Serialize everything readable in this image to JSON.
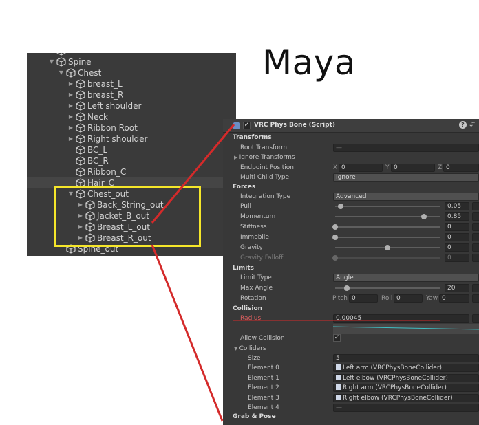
{
  "title": "Maya",
  "hierarchy": {
    "rows": [
      {
        "label": "",
        "depth": 2,
        "arrow": "",
        "icon": "cube-icon",
        "partial": true
      },
      {
        "label": "Spine",
        "depth": 2,
        "arrow": "▼",
        "icon": "cube-icon"
      },
      {
        "label": "Chest",
        "depth": 3,
        "arrow": "▼",
        "icon": "cube-icon"
      },
      {
        "label": "breast_L",
        "depth": 4,
        "arrow": "▶",
        "icon": "cube-icon"
      },
      {
        "label": "breast_R",
        "depth": 4,
        "arrow": "▶",
        "icon": "cube-icon"
      },
      {
        "label": "Left shoulder",
        "depth": 4,
        "arrow": "▶",
        "icon": "cube-icon"
      },
      {
        "label": "Neck",
        "depth": 4,
        "arrow": "▶",
        "icon": "cube-icon"
      },
      {
        "label": "Ribbon Root",
        "depth": 4,
        "arrow": "▶",
        "icon": "cube-icon"
      },
      {
        "label": "Right shoulder",
        "depth": 4,
        "arrow": "▶",
        "icon": "cube-icon"
      },
      {
        "label": "BC_L",
        "depth": 4,
        "arrow": "",
        "icon": "cube-icon"
      },
      {
        "label": "BC_R",
        "depth": 4,
        "arrow": "",
        "icon": "cube-icon"
      },
      {
        "label": "Ribbon_C",
        "depth": 4,
        "arrow": "",
        "icon": "cube-icon"
      },
      {
        "label": "Hair_C",
        "depth": 4,
        "arrow": "",
        "icon": "cube-icon",
        "selected": true
      },
      {
        "label": "Chest_out",
        "depth": 4,
        "arrow": "▼",
        "icon": "cube-icon"
      },
      {
        "label": "Back_String_out",
        "depth": 5,
        "arrow": "▶",
        "icon": "cube-icon"
      },
      {
        "label": "Jacket_B_out",
        "depth": 5,
        "arrow": "▶",
        "icon": "cube-icon"
      },
      {
        "label": "Breast_L_out",
        "depth": 5,
        "arrow": "▶",
        "icon": "cube-icon"
      },
      {
        "label": "Breast_R_out",
        "depth": 5,
        "arrow": "▶",
        "icon": "cube-icon"
      },
      {
        "label": "Spine_out",
        "depth": 3,
        "arrow": "",
        "icon": "cube-icon",
        "partial": true
      }
    ]
  },
  "inspector": {
    "component_title": "VRC Phys Bone (Script)",
    "enabled": "✓",
    "help_icon": "help-icon",
    "preset_icon": "preset-icon",
    "sections": {
      "transforms": "Transforms",
      "forces": "Forces",
      "limits": "Limits",
      "collision": "Collision",
      "grab_pose": "Grab & Pose"
    },
    "root_transform": {
      "label": "Root Transform",
      "value": "—"
    },
    "ignore_transforms": {
      "label": "Ignore Transforms"
    },
    "endpoint_position": {
      "label": "Endpoint Position",
      "x": "0",
      "y": "0",
      "z": "0"
    },
    "multi_child_type": {
      "label": "Multi Child Type",
      "value": "Ignore"
    },
    "integration_type": {
      "label": "Integration Type",
      "value": "Advanced"
    },
    "pull": {
      "label": "Pull",
      "value": "0.05",
      "level": 0.05
    },
    "momentum": {
      "label": "Momentum",
      "value": "0.85",
      "level": 0.85
    },
    "stiffness": {
      "label": "Stiffness",
      "value": "0",
      "level": 0
    },
    "immobile": {
      "label": "Immobile",
      "value": "0",
      "level": 0
    },
    "gravity": {
      "label": "Gravity",
      "value": "0",
      "level": 0.5
    },
    "gravity_falloff": {
      "label": "Gravity Falloff",
      "value": "0",
      "level": 0
    },
    "limit_type": {
      "label": "Limit Type",
      "value": "Angle"
    },
    "max_angle": {
      "label": "Max Angle",
      "value": "20",
      "level": 0.11
    },
    "rotation": {
      "label": "Rotation",
      "pitch_label": "Pitch",
      "pitch": "0",
      "roll_label": "Roll",
      "roll": "0",
      "yaw_label": "Yaw",
      "yaw": "0"
    },
    "radius": {
      "label": "Radius",
      "value": "0.00045"
    },
    "allow_collision": {
      "label": "Allow Collision",
      "value": "✓"
    },
    "colliders": {
      "label": "Colliders",
      "size_label": "Size",
      "size": "5",
      "elements": [
        {
          "label": "Element 0",
          "value": "Left arm (VRCPhysBoneCollider)"
        },
        {
          "label": "Element 1",
          "value": "Left elbow (VRCPhysBoneCollider)"
        },
        {
          "label": "Element 2",
          "value": "Right arm (VRCPhysBoneCollider)"
        },
        {
          "label": "Element 3",
          "value": "Right elbow (VRCPhysBoneCollider)"
        },
        {
          "label": "Element 4",
          "value": "—"
        }
      ]
    }
  },
  "colors": {
    "highlight_box": "#f5e62a",
    "connector_line": "#d42a2a",
    "panel_bg": "#383838"
  }
}
